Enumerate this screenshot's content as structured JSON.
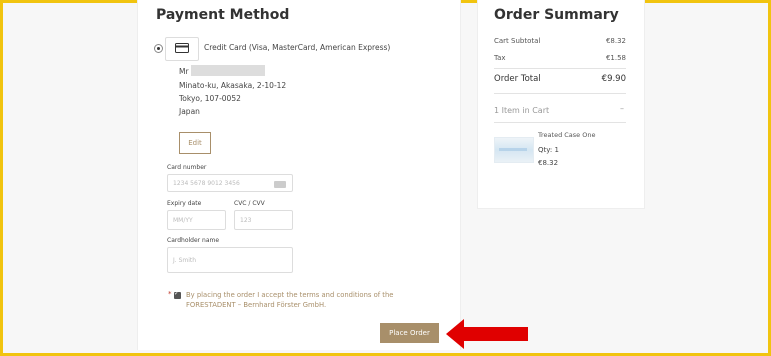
{
  "payment": {
    "title": "Payment Method",
    "method_label": "Credit Card (Visa, MasterCard, American Express)",
    "address": {
      "salutation": "Mr",
      "line1": "Minato-ku, Akasaka, 2-10-12",
      "line2": "Tokyo, 107-0052",
      "country": "Japan"
    },
    "edit_label": "Edit",
    "card_number": {
      "label": "Card number",
      "placeholder": "1234 5678 9012 3456"
    },
    "expiry": {
      "label": "Expiry date",
      "placeholder": "MM/YY"
    },
    "cvc": {
      "label": "CVC / CVV",
      "placeholder": "123"
    },
    "cardholder": {
      "label": "Cardholder name",
      "placeholder": "J. Smith"
    },
    "terms_required_mark": "*",
    "terms_text": "By placing the order I accept the terms and conditions of the FORESTADENT – Bernhard Förster GmbH.",
    "place_order_label": "Place Order"
  },
  "summary": {
    "title": "Order Summary",
    "subtotal_label": "Cart Subtotal",
    "subtotal_value": "€8.32",
    "tax_label": "Tax",
    "tax_value": "€1.58",
    "total_label": "Order Total",
    "total_value": "€9.90",
    "items_label": "1 Item in Cart",
    "items_toggle": "–",
    "item": {
      "name": "Treated Case One",
      "qty": "Qty: 1",
      "price": "€8.32"
    }
  },
  "colors": {
    "accent": "#a88f6a",
    "highlight_border": "#f1c40f",
    "arrow": "#e00000"
  }
}
